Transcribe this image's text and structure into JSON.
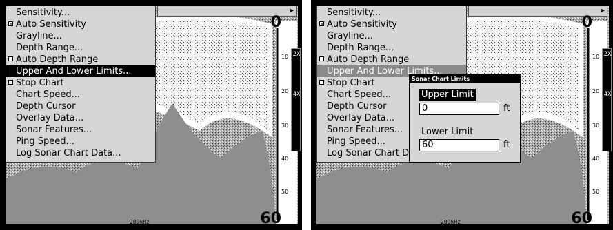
{
  "left_panel": {
    "menu_items": [
      {
        "label": "Sensitivity...",
        "checkbox": false,
        "checked": false,
        "selected": false
      },
      {
        "label": "Auto Sensitivity",
        "checkbox": true,
        "checked": true,
        "selected": false
      },
      {
        "label": "Grayline...",
        "checkbox": false,
        "checked": false,
        "selected": false
      },
      {
        "label": "Depth Range...",
        "checkbox": false,
        "checked": false,
        "selected": false
      },
      {
        "label": "Auto Depth Range",
        "checkbox": true,
        "checked": false,
        "selected": false
      },
      {
        "label": "Upper And Lower Limits...",
        "checkbox": false,
        "checked": false,
        "selected": true
      },
      {
        "label": "Stop Chart",
        "checkbox": true,
        "checked": false,
        "selected": false
      },
      {
        "label": "Chart Speed...",
        "checkbox": false,
        "checked": false,
        "selected": false
      },
      {
        "label": "Depth Cursor",
        "checkbox": false,
        "checked": false,
        "selected": false
      },
      {
        "label": "Overlay Data...",
        "checkbox": false,
        "checked": false,
        "selected": false
      },
      {
        "label": "Sonar Features...",
        "checkbox": false,
        "checked": false,
        "selected": false
      },
      {
        "label": "Ping Speed...",
        "checkbox": false,
        "checked": false,
        "selected": false
      },
      {
        "label": "Log Sonar Chart Data...",
        "checkbox": false,
        "checked": false,
        "selected": false
      }
    ]
  },
  "right_panel": {
    "menu_items": [
      {
        "label": "Sensitivity...",
        "checkbox": false,
        "checked": false,
        "selected": false
      },
      {
        "label": "Auto Sensitivity",
        "checkbox": true,
        "checked": true,
        "selected": false
      },
      {
        "label": "Grayline...",
        "checkbox": false,
        "checked": false,
        "selected": false
      },
      {
        "label": "Depth Range...",
        "checkbox": false,
        "checked": false,
        "selected": false
      },
      {
        "label": "Auto Depth Range",
        "checkbox": true,
        "checked": false,
        "selected": false
      },
      {
        "label": "Upper And Lower Limits...",
        "checkbox": false,
        "checked": false,
        "selected": true
      },
      {
        "label": "Stop Chart",
        "checkbox": true,
        "checked": false,
        "selected": false
      },
      {
        "label": "Chart Speed...",
        "checkbox": false,
        "checked": false,
        "selected": false
      },
      {
        "label": "Depth Cursor",
        "checkbox": false,
        "checked": false,
        "selected": false
      },
      {
        "label": "Overlay Data...",
        "checkbox": false,
        "checked": false,
        "selected": false
      },
      {
        "label": "Sonar Features...",
        "checkbox": false,
        "checked": false,
        "selected": false
      },
      {
        "label": "Ping Speed...",
        "checkbox": false,
        "checked": false,
        "selected": false
      },
      {
        "label": "Log Sonar Chart Data...",
        "checkbox": false,
        "checked": false,
        "selected": false
      }
    ],
    "dialog": {
      "title": "Sonar Chart Limits",
      "upper_label": "Upper Limit",
      "upper_value": "0",
      "lower_label": "Lower Limit",
      "lower_value": "60",
      "unit": "ft"
    }
  },
  "sonar": {
    "depth_top": "0",
    "depth_bottom": "60",
    "frequency": "200kHz",
    "zoom_labels": [
      "2X",
      "4X"
    ],
    "depth_ticks": [
      "10",
      "20",
      "30",
      "40",
      "50"
    ]
  },
  "colors": {
    "menu_bg": "#d6d6d6",
    "selected_bg": "#000000",
    "selected_dim_bg": "#8a8a8a"
  }
}
